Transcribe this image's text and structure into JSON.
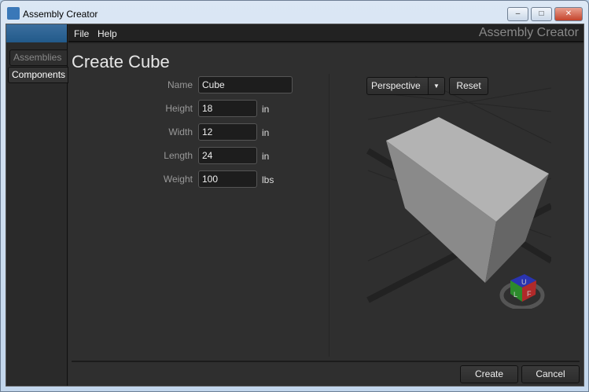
{
  "window": {
    "title": "Assembly Creator"
  },
  "menu": {
    "items": [
      "File",
      "Help"
    ],
    "brand": "Assembly Creator"
  },
  "sidebar": {
    "tabs": [
      "Assemblies",
      "Components"
    ],
    "active": "Components"
  },
  "form": {
    "title": "Create Cube",
    "fields": [
      {
        "label": "Name",
        "value": "Cube",
        "unit": ""
      },
      {
        "label": "Height",
        "value": "18",
        "unit": "in"
      },
      {
        "label": "Width",
        "value": "12",
        "unit": "in"
      },
      {
        "label": "Length",
        "value": "24",
        "unit": "in"
      },
      {
        "label": "Weight",
        "value": "100",
        "unit": "lbs"
      }
    ]
  },
  "viewport": {
    "view_mode": "Perspective",
    "reset_label": "Reset",
    "gizmo": {
      "up": "U",
      "left": "L",
      "front": "F"
    }
  },
  "actions": {
    "create": "Create",
    "cancel": "Cancel"
  }
}
